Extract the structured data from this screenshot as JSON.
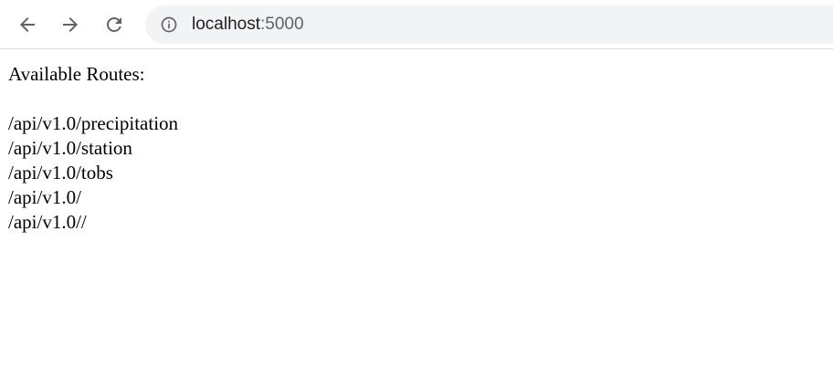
{
  "browser": {
    "icons": {
      "back": "arrow-left-icon",
      "forward": "arrow-right-icon",
      "reload": "reload-icon",
      "site_info": "info-icon"
    },
    "address": {
      "host": "localhost",
      "port": ":5000"
    }
  },
  "page": {
    "heading": "Available Routes:",
    "routes": [
      "/api/v1.0/precipitation",
      "/api/v1.0/station",
      "/api/v1.0/tobs",
      "/api/v1.0/",
      "/api/v1.0//"
    ]
  },
  "colors": {
    "omnibox_bg": "#f1f3f4",
    "icon": "#5f6368",
    "url_host": "#202124",
    "text": "#000000"
  }
}
